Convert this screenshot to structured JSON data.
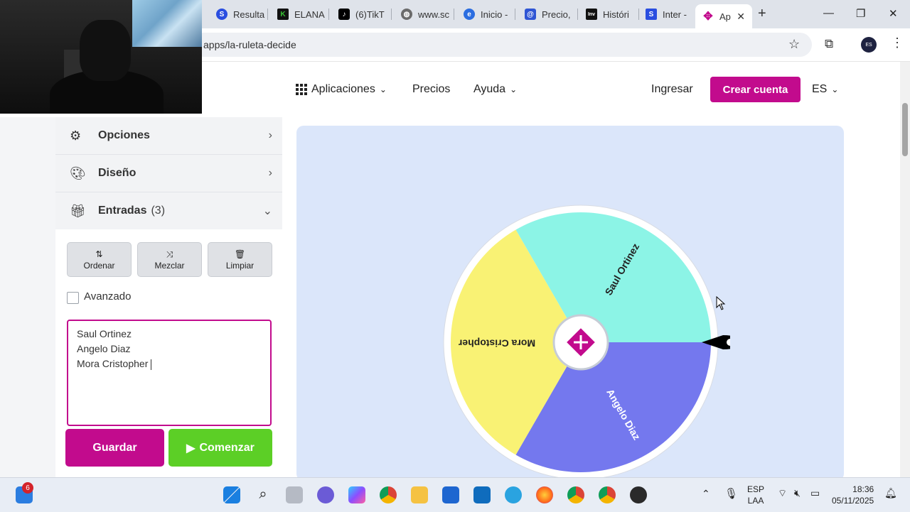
{
  "browser": {
    "tabs": [
      {
        "label": "Resulta",
        "icon": "s-logo-icon",
        "color": "#2a4ee0"
      },
      {
        "label": "ELANA",
        "icon": "k-logo-icon",
        "color": "#38c234"
      },
      {
        "label": "(6)TikT",
        "icon": "tiktok-icon",
        "color": "#000000"
      },
      {
        "label": "www.sc",
        "icon": "globe-icon",
        "color": "#6b6b6b"
      },
      {
        "label": "Inicio -",
        "icon": "edge-e-icon",
        "color": "#2b6de0"
      },
      {
        "label": "Precio,",
        "icon": "at-icon",
        "color": "#2f55d4"
      },
      {
        "label": "Históri",
        "icon": "inv-logo-icon",
        "color": "#111111"
      },
      {
        "label": "Inter -",
        "icon": "doc-icon",
        "color": "#2a4ee0"
      },
      {
        "label": "Ap",
        "icon": "app-logo-icon",
        "color": "#c20b8d",
        "active": true
      }
    ],
    "url": "apps/la-ruleta-decide",
    "profile_initials": "ES"
  },
  "nav": {
    "apps_label": "Aplicaciones",
    "pricing_label": "Precios",
    "help_label": "Ayuda",
    "login_label": "Ingresar",
    "signup_label": "Crear cuenta",
    "lang_label": "ES"
  },
  "sidebar": {
    "options_label": "Opciones",
    "design_label": "Diseño",
    "entries_label": "Entradas",
    "entries_count": "(3)",
    "sort_label": "Ordenar",
    "shuffle_label": "Mezclar",
    "clear_label": "Limpiar",
    "advanced_label": "Avanzado",
    "entries": [
      "Saul Ortinez",
      "Angelo Diaz",
      "Mora Cristopher "
    ],
    "save_label": "Guardar",
    "start_label": "Comenzar"
  },
  "wheel": {
    "segments": [
      {
        "label": "Saul Ortinez",
        "color": "#8cf4e6",
        "text_color": "#222222"
      },
      {
        "label": "Angelo Diaz",
        "color": "#7478ee",
        "text_color": "#ffffff"
      },
      {
        "label": "Mora Cristopher",
        "color": "#f9f274",
        "text_color": "#222222"
      }
    ],
    "center_color": "#c20b8d"
  },
  "taskbar": {
    "badge_count": "6",
    "lang_top": "ESP",
    "lang_bottom": "LAA",
    "time": "18:36",
    "date": "05/11/2025"
  }
}
